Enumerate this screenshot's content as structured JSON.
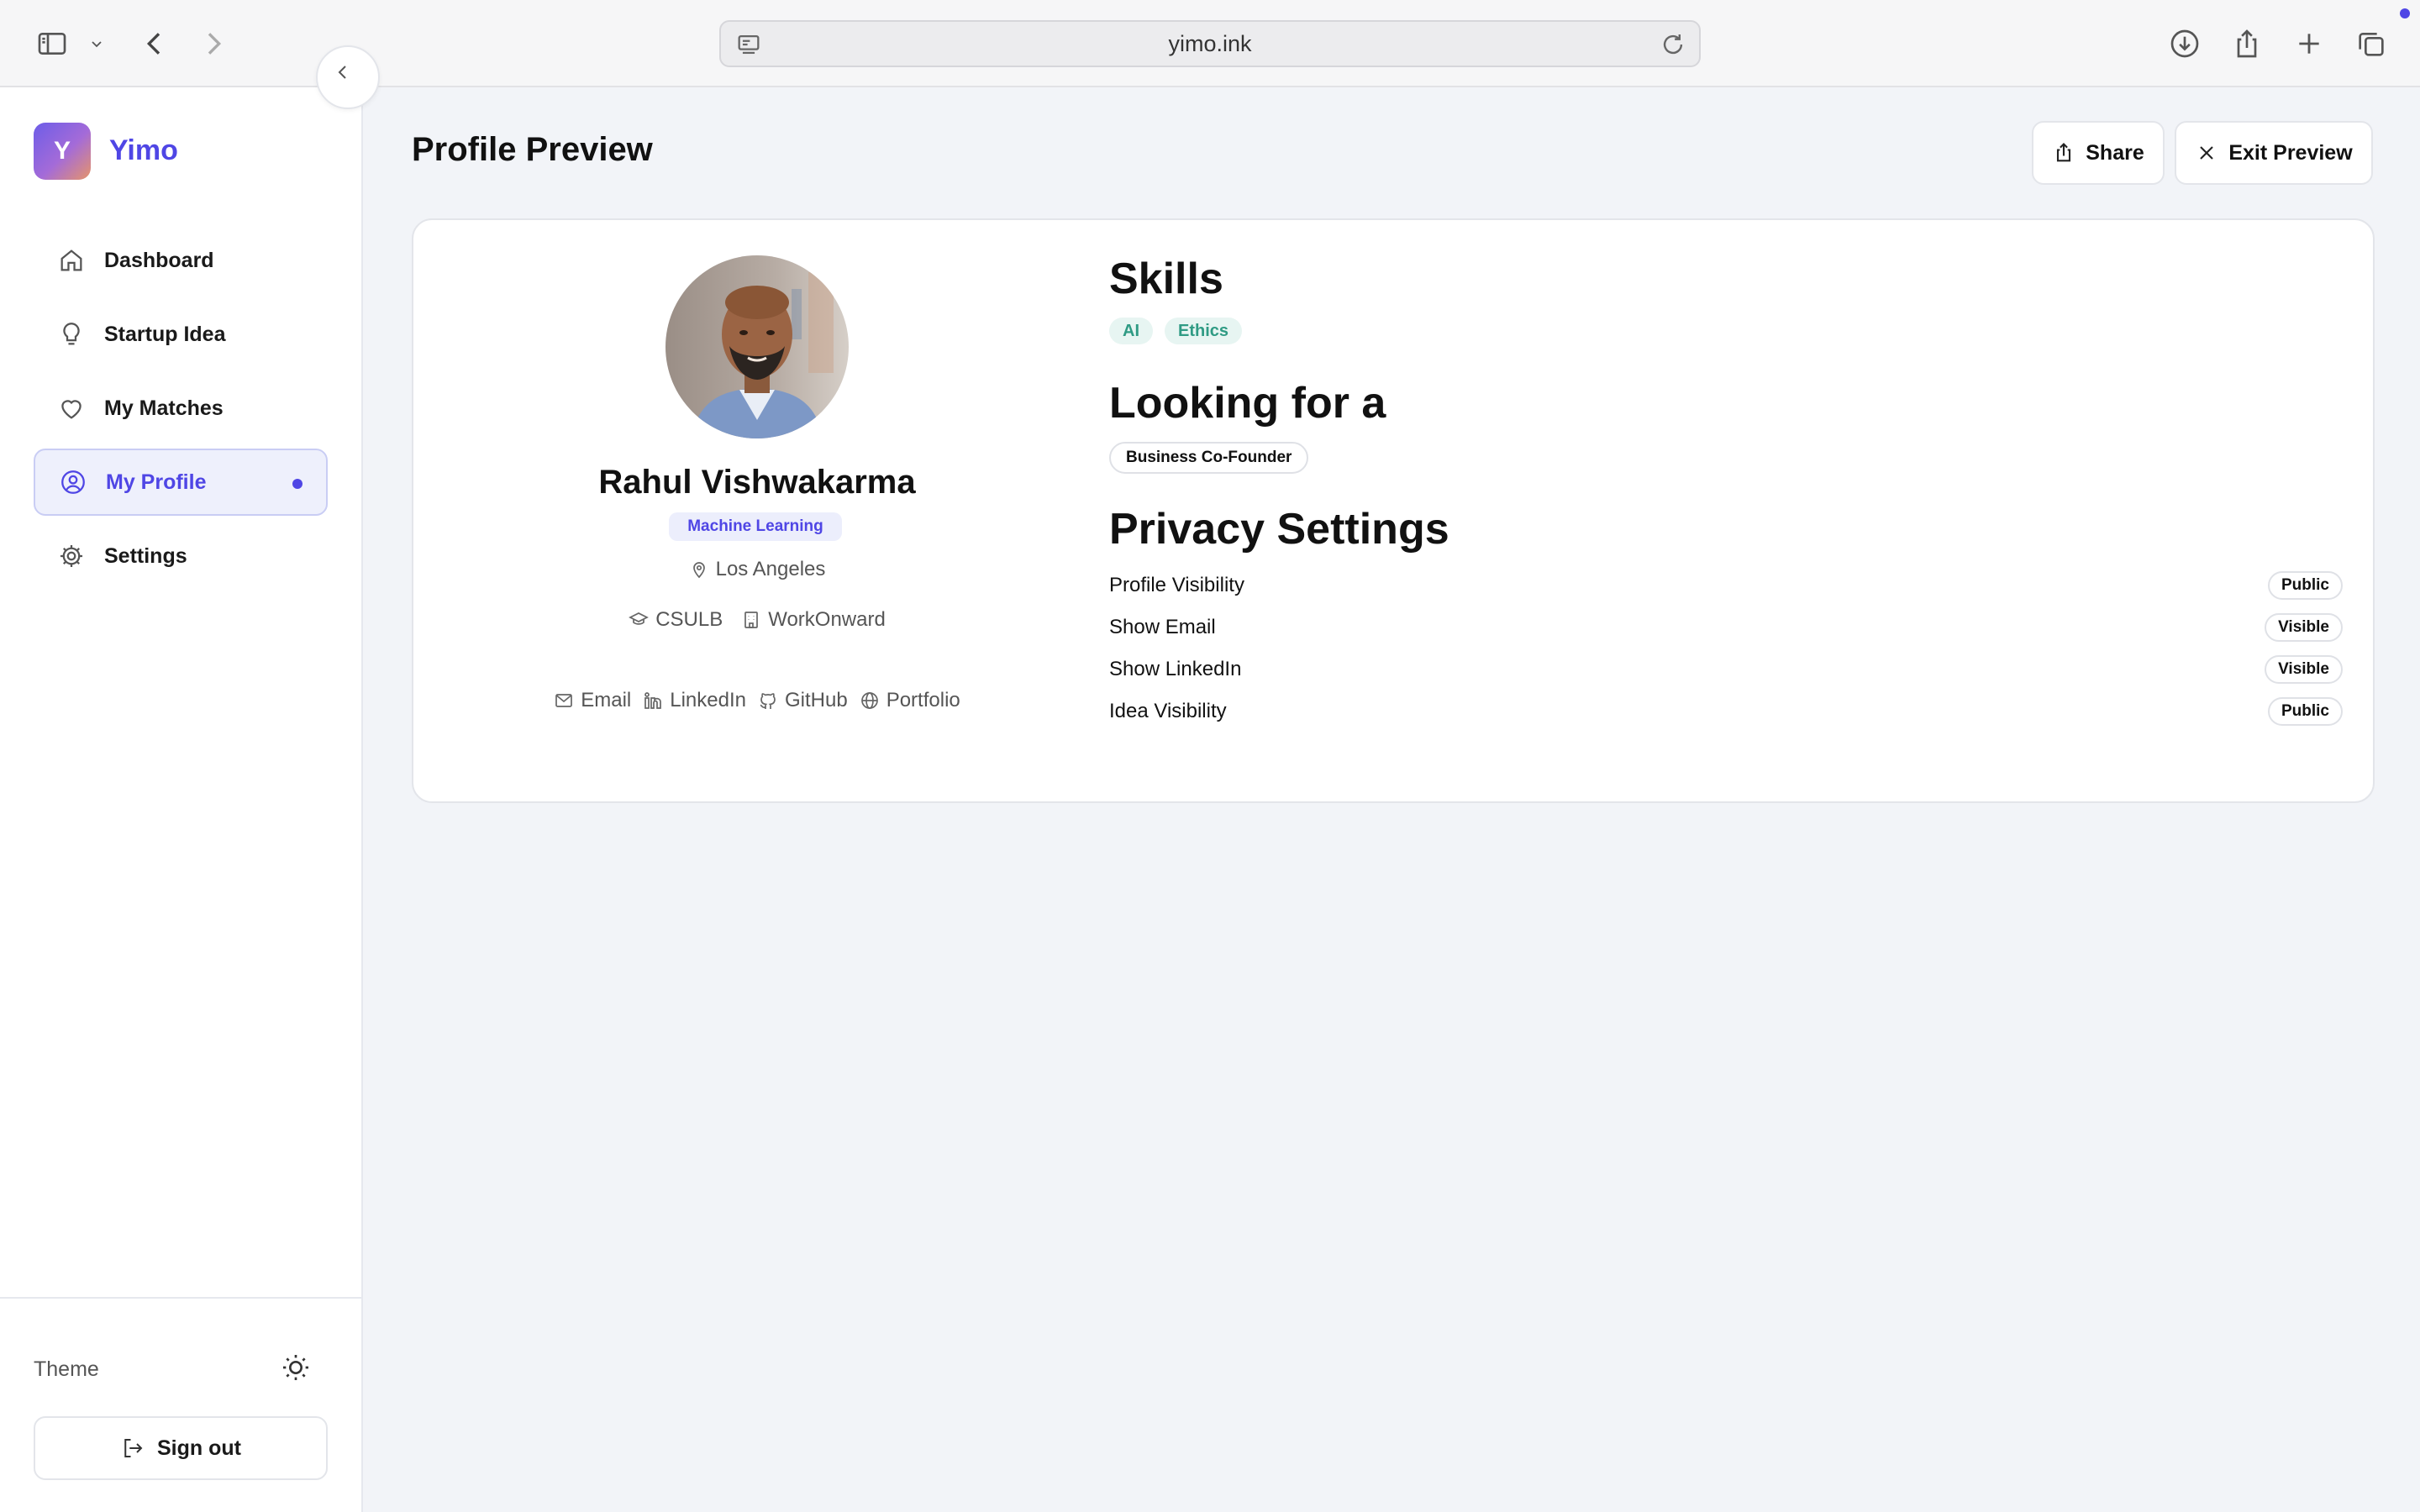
{
  "browser": {
    "url": "yimo.ink"
  },
  "sidebar": {
    "logo_letter": "Y",
    "app_name": "Yimo",
    "items": [
      {
        "label": "Dashboard",
        "icon": "home-icon"
      },
      {
        "label": "Startup Idea",
        "icon": "lightbulb-icon"
      },
      {
        "label": "My Matches",
        "icon": "heart-icon"
      },
      {
        "label": "My Profile",
        "icon": "user-circle-icon",
        "active": true
      },
      {
        "label": "Settings",
        "icon": "gear-icon"
      }
    ],
    "theme_label": "Theme",
    "signout_label": "Sign out"
  },
  "header": {
    "title": "Profile Preview",
    "share_label": "Share",
    "exit_label": "Exit Preview"
  },
  "profile": {
    "name": "Rahul Vishwakarma",
    "role": "Machine Learning",
    "location": "Los Angeles",
    "education": "CSULB",
    "company": "WorkOnward",
    "links": [
      "Email",
      "LinkedIn",
      "GitHub",
      "Portfolio"
    ]
  },
  "skills": {
    "title": "Skills",
    "items": [
      "AI",
      "Ethics"
    ]
  },
  "looking_for": {
    "title": "Looking for a",
    "items": [
      "Business Co-Founder"
    ]
  },
  "privacy": {
    "title": "Privacy Settings",
    "rows": [
      {
        "label": "Profile Visibility",
        "value": "Public"
      },
      {
        "label": "Show Email",
        "value": "Visible"
      },
      {
        "label": "Show LinkedIn",
        "value": "Visible"
      },
      {
        "label": "Idea Visibility",
        "value": "Public"
      }
    ]
  },
  "colors": {
    "accent": "#4f46e5",
    "skill_chip_bg": "#e7f5f2",
    "skill_chip_text": "#2f9b84"
  }
}
